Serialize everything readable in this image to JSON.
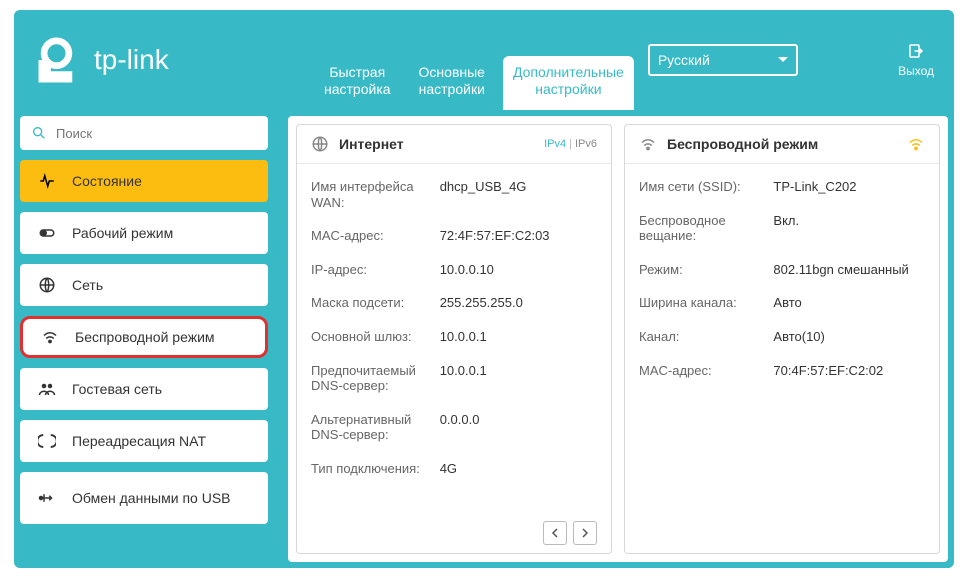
{
  "brand": "tp-link",
  "tabs": [
    "Быстрая\nнастройка",
    "Основные\nнастройки",
    "Дополнительные\nнастройки"
  ],
  "active_tab": 2,
  "language_label": "Русский",
  "logout_label": "Выход",
  "search": {
    "placeholder": "Поиск"
  },
  "sidebar": {
    "items": [
      {
        "label": "Состояние",
        "icon": "activity"
      },
      {
        "label": "Рабочий режим",
        "icon": "toggle"
      },
      {
        "label": "Сеть",
        "icon": "globe"
      },
      {
        "label": "Беспроводной режим",
        "icon": "wifi"
      },
      {
        "label": "Гостевая сеть",
        "icon": "guests"
      },
      {
        "label": "Переадресация NAT",
        "icon": "nat"
      },
      {
        "label": "Обмен данными по USB",
        "icon": "usb"
      }
    ],
    "active": 0,
    "highlighted": 3
  },
  "cards": {
    "internet": {
      "title": "Интернет",
      "ipv4": "IPv4",
      "ipv6": "IPv6",
      "rows": [
        {
          "k": "Имя интерфейса WAN:",
          "v": "dhcp_USB_4G"
        },
        {
          "k": "MAC-адрес:",
          "v": "72:4F:57:EF:C2:03"
        },
        {
          "k": "IP-адрес:",
          "v": "10.0.0.10"
        },
        {
          "k": "Маска подсети:",
          "v": "255.255.255.0"
        },
        {
          "k": "Основной шлюз:",
          "v": "10.0.0.1"
        },
        {
          "k": "Предпочитаемый DNS-сервер:",
          "v": "10.0.0.1"
        },
        {
          "k": "Альтернативный DNS-сервер:",
          "v": "0.0.0.0"
        },
        {
          "k": "Тип подключения:",
          "v": "4G"
        }
      ]
    },
    "wireless": {
      "title": "Беспроводной режим",
      "rows": [
        {
          "k": "Имя сети (SSID):",
          "v": "TP-Link_C202"
        },
        {
          "k": "Беспроводное вещание:",
          "v": "Вкл."
        },
        {
          "k": "Режим:",
          "v": "802.11bgn смешанный"
        },
        {
          "k": "Ширина канала:",
          "v": "Авто"
        },
        {
          "k": "Канал:",
          "v": "Авто(10)"
        },
        {
          "k": "MAC-адрес:",
          "v": "70:4F:57:EF:C2:02"
        }
      ]
    }
  }
}
